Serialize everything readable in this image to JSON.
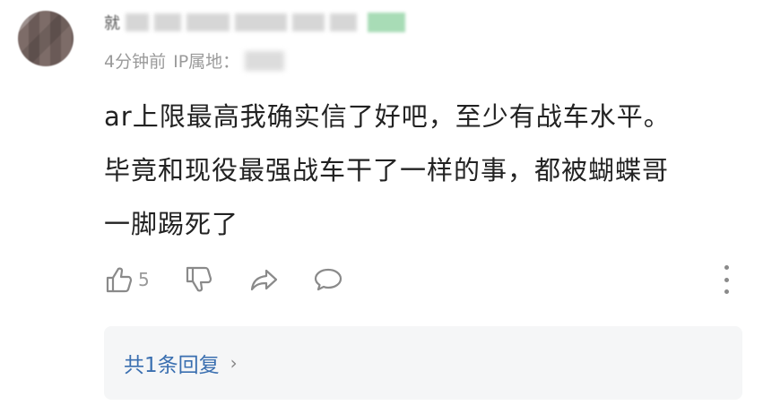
{
  "comment": {
    "author": {
      "visible_char": "就"
    },
    "meta": {
      "time": "4分钟前",
      "ip_label": "IP属地："
    },
    "text": "ar上限最高我确实信了好吧，至少有战车水平。\n毕竟和现役最强战车干了一样的事，都被蝴蝶哥\n一脚踢死了",
    "actions": {
      "like_count": "5",
      "like_icon": "thumbs-up-icon",
      "dislike_icon": "thumbs-down-icon",
      "share_icon": "share-icon",
      "reply_icon": "comment-bubble-icon",
      "more_icon": "more-vertical-icon"
    },
    "replies": {
      "label": "共1条回复",
      "chevron": "›"
    }
  },
  "colors": {
    "text": "#222222",
    "meta": "#9a9a9a",
    "icon": "#8a8a8a",
    "link": "#3a6fb0",
    "reply_bg": "#f5f6f7"
  }
}
